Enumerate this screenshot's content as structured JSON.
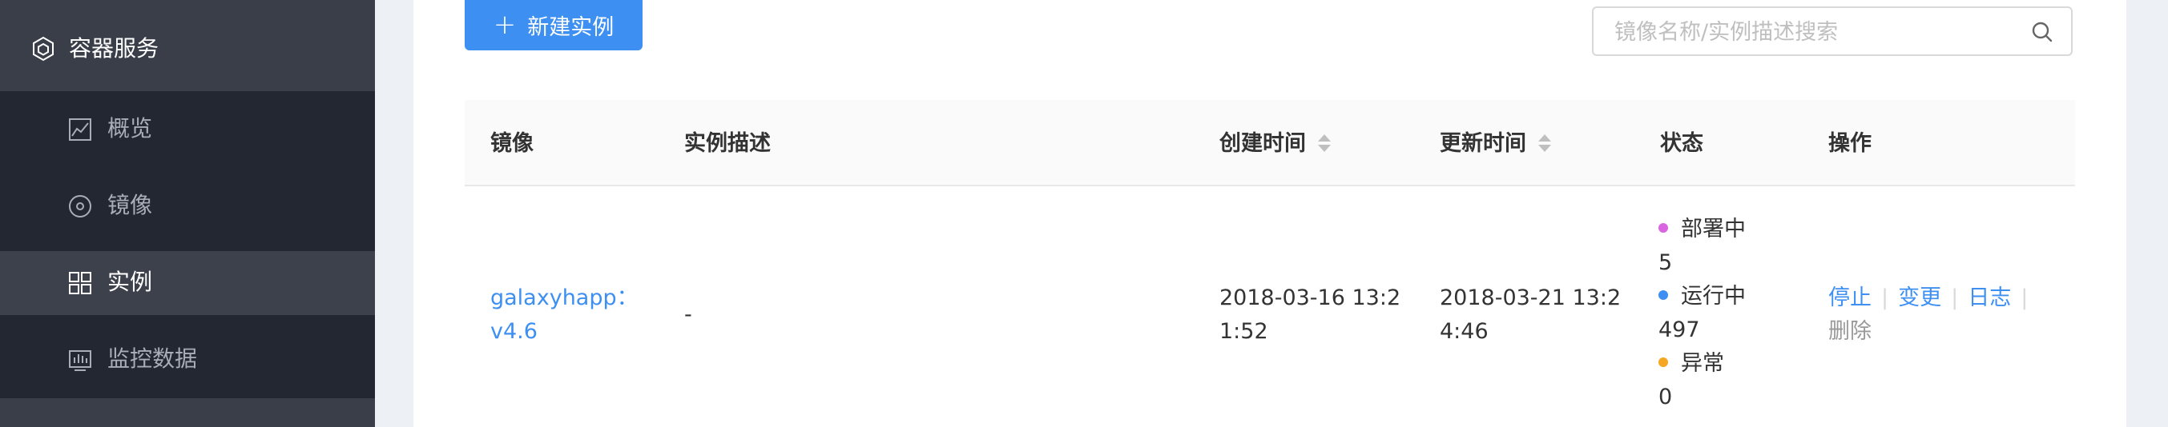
{
  "sidebar": {
    "header": {
      "icon": "container-hexagon-icon",
      "label": "容器服务"
    },
    "items": [
      {
        "icon": "chart-line-icon",
        "label": "概览",
        "active": false
      },
      {
        "icon": "disc-icon",
        "label": "镜像",
        "active": false
      },
      {
        "icon": "grid-icon",
        "label": "实例",
        "active": true
      },
      {
        "icon": "monitor-bars-icon",
        "label": "监控数据",
        "active": false
      }
    ]
  },
  "toolbar": {
    "new_button_label": "新建实例",
    "search": {
      "placeholder": "镜像名称/实例描述搜索",
      "value": ""
    }
  },
  "table": {
    "columns": [
      "镜像",
      "实例描述",
      "创建时间",
      "更新时间",
      "状态",
      "操作"
    ],
    "sortable_columns": [
      "创建时间",
      "更新时间"
    ],
    "rows": [
      {
        "image_line1": "galaxyhapp：",
        "image_line2": "v4.6",
        "description": "-",
        "created_line1": "2018-03-16 13:2",
        "created_line2": "1:52",
        "updated_line1": "2018-03-21 13:2",
        "updated_line2": "4:46",
        "status": [
          {
            "label": "部署中",
            "count": "5",
            "color": "#d966e0"
          },
          {
            "label": "运行中",
            "count": "497",
            "color": "#3d8ff2"
          },
          {
            "label": "异常",
            "count": "0",
            "color": "#f5a623"
          }
        ],
        "actions": {
          "stop": "停止",
          "change": "变更",
          "log": "日志",
          "delete": "删除"
        }
      }
    ]
  },
  "colors": {
    "accent": "#3d8ff2",
    "sidebar_bg": "#222731",
    "sidebar_active": "#3c414c"
  }
}
